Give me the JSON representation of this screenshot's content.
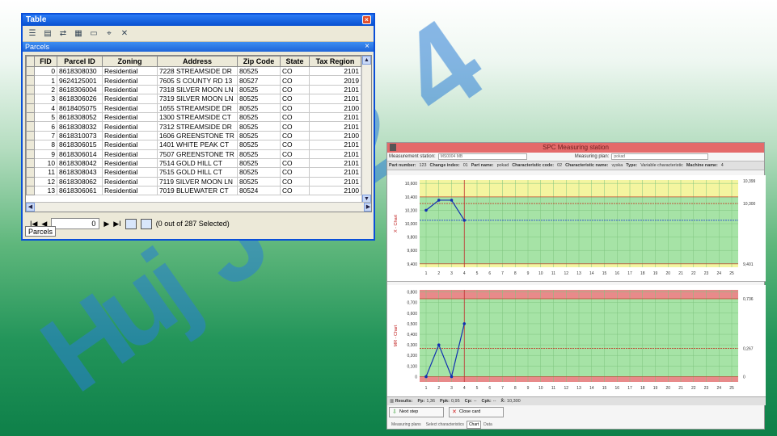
{
  "watermark": {
    "text": "HujJs24"
  },
  "table_window": {
    "title": "Table",
    "close_symbol": "×",
    "toolbar_icons": [
      "table-options-icon",
      "select-by-attributes-icon",
      "switch-selection-icon",
      "select-all-icon",
      "clear-selection-icon",
      "zoom-to-selected-icon",
      "delete-selected-icon"
    ],
    "tab_title": "Parcels",
    "tab_close": "×",
    "columns": [
      "",
      "FID",
      "Parcel ID",
      "Zoning",
      "Address",
      "Zip Code",
      "State",
      "Tax Region"
    ],
    "rows": [
      [
        "0",
        "8618308030",
        "Residential",
        "7228 STREAMSIDE DR",
        "80525",
        "CO",
        "2101"
      ],
      [
        "1",
        "9624125001",
        "Residential",
        "7605 S COUNTY RD 13",
        "80527",
        "CO",
        "2019"
      ],
      [
        "2",
        "8618306004",
        "Residential",
        "7318 SILVER MOON LN",
        "80525",
        "CO",
        "2101"
      ],
      [
        "3",
        "8618306026",
        "Residential",
        "7319 SILVER MOON LN",
        "80525",
        "CO",
        "2101"
      ],
      [
        "4",
        "8618405075",
        "Residential",
        "1655 STREAMSIDE DR",
        "80525",
        "CO",
        "2100"
      ],
      [
        "5",
        "8618308052",
        "Residential",
        "1300 STREAMSIDE CT",
        "80525",
        "CO",
        "2101"
      ],
      [
        "6",
        "8618308032",
        "Residential",
        "7312 STREAMSIDE DR",
        "80525",
        "CO",
        "2101"
      ],
      [
        "7",
        "8618310073",
        "Residential",
        "1606 GREENSTONE TR",
        "80525",
        "CO",
        "2100"
      ],
      [
        "8",
        "8618306015",
        "Residential",
        "1401 WHITE PEAK CT",
        "80525",
        "CO",
        "2101"
      ],
      [
        "9",
        "8618306014",
        "Residential",
        "7507 GREENSTONE TR",
        "80525",
        "CO",
        "2101"
      ],
      [
        "10",
        "8618308042",
        "Residential",
        "7514 GOLD HILL CT",
        "80525",
        "CO",
        "2101"
      ],
      [
        "11",
        "8618308043",
        "Residential",
        "7515 GOLD HILL CT",
        "80525",
        "CO",
        "2101"
      ],
      [
        "12",
        "8618308062",
        "Residential",
        "7119 SILVER MOON LN",
        "80525",
        "CO",
        "2101"
      ],
      [
        "13",
        "8618306061",
        "Residential",
        "7019 BLUEWATER CT",
        "80524",
        "CO",
        "2100"
      ]
    ],
    "nav": {
      "first": "I◀",
      "prev": "◀",
      "record": "0",
      "next": "▶",
      "last": "▶I",
      "selection_text": "(0 out of 287 Selected)"
    },
    "bottom_tab": "Parcels"
  },
  "spc": {
    "title": "SPC Measuring station",
    "measurement_station_label": "Measurement station:",
    "measurement_station_value": "MS0004 MB",
    "measuring_plan_label": "Measuring plan:",
    "measuring_plan_value": "pokad",
    "info": [
      {
        "label": "Part number:",
        "value": "123"
      },
      {
        "label": "Change index:",
        "value": "01"
      },
      {
        "label": "Part name:",
        "value": "pokad"
      },
      {
        "label": "Characteristic code:",
        "value": "02"
      },
      {
        "label": "Characteristic name:",
        "value": "vyska"
      },
      {
        "label": "Type:",
        "value": "Variable characteristic"
      },
      {
        "label": "Machine name:",
        "value": "4"
      }
    ],
    "results_label": "Results:",
    "results": [
      {
        "label": "Pp:",
        "value": "1,36"
      },
      {
        "label": "Ppk:",
        "value": "0,95"
      },
      {
        "label": "Cp:",
        "value": "--"
      },
      {
        "label": "Cpk:",
        "value": "--"
      },
      {
        "label": "X̄:",
        "value": "10,300"
      }
    ],
    "buttons": {
      "next": "Next step",
      "close": "Close card"
    },
    "tabs": [
      "Measuring plans",
      "Select characteristics",
      "Chart",
      "Data"
    ]
  },
  "chart_data": [
    {
      "type": "line",
      "ylabel": "X - Chart",
      "x": [
        1,
        2,
        3,
        4
      ],
      "values": [
        10.2,
        10.35,
        10.35,
        10.05
      ],
      "x_ticks": [
        1,
        2,
        3,
        4,
        5,
        6,
        7,
        8,
        9,
        10,
        11,
        12,
        13,
        14,
        15,
        16,
        17,
        18,
        19,
        20,
        21,
        22,
        23,
        24,
        25
      ],
      "y_ticks": [
        "9,400",
        "9,600",
        "9,800",
        "10,000",
        "10,200",
        "10,400",
        "10,600"
      ],
      "ylim": [
        9.35,
        10.65
      ],
      "right_labels": [
        "10,399",
        "10,300",
        "9,401"
      ],
      "limits": {
        "upper": 10.399,
        "upper_ref": 10.3,
        "center": 10.05,
        "lower": 9.401
      },
      "marker_x": 4,
      "colors": {
        "series": "#1030b0",
        "limit": "#c0402b",
        "center": "#2244cc",
        "band": "#f4f5a0",
        "zone": "#a6e3a6"
      }
    },
    {
      "type": "line",
      "ylabel": "MR - Chart",
      "x": [
        1,
        2,
        3,
        4
      ],
      "values": [
        0,
        0.3,
        0,
        0.5
      ],
      "x_ticks": [
        1,
        2,
        3,
        4,
        5,
        6,
        7,
        8,
        9,
        10,
        11,
        12,
        13,
        14,
        15,
        16,
        17,
        18,
        19,
        20,
        21,
        22,
        23,
        24,
        25
      ],
      "y_ticks": [
        "0",
        "0,100",
        "0,200",
        "0,300",
        "0,400",
        "0,500",
        "0,600",
        "0,700",
        "0,800"
      ],
      "ylim": [
        -0.05,
        0.82
      ],
      "right_labels": [
        "0,736",
        "0,267",
        "0"
      ],
      "limits": {
        "upper": 0.736,
        "center": 0.267,
        "lower": 0
      },
      "marker_x": 4,
      "colors": {
        "series": "#1030b0",
        "limit": "#c0402b",
        "center": "#c0402b",
        "band": "#e88a8a",
        "zone": "#a6e3a6"
      }
    }
  ]
}
